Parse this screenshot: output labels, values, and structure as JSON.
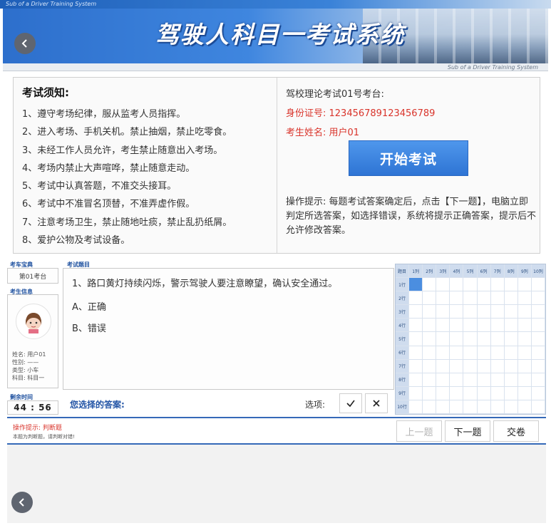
{
  "header": {
    "top_caption": "Sub of a Driver Training System",
    "title": "驾驶人科目一考试系统",
    "sub_caption": "Sub of a Driver Training System"
  },
  "rules": {
    "heading": "考试须知:",
    "items": [
      "1、遵守考场纪律，服从监考人员指挥。",
      "2、进入考场、手机关机。禁止抽烟，禁止吃零食。",
      "3、未经工作人员允许，考生禁止随意出入考场。",
      "4、考场内禁止大声喧哗，禁止随意走动。",
      "5、考试中认真答题，不准交头接耳。",
      "6、考试中不准冒名顶替，不准弄虚作假。",
      "7、注意考场卫生，禁止随地吐痰，禁止乱扔纸屑。",
      "8、爱护公物及考试设备。"
    ]
  },
  "exam_info": {
    "hall": "驾校理论考试01号考台:",
    "id_card": "身份证号: 123456789123456789",
    "name": "考生姓名: 用户01",
    "start_button": "开始考试",
    "tip": "操作提示: 每题考试答案确定后，点击【下一题】，电脑立即判定所选答案，如选择错误，系统将提示正确答案，提示后不允许修改答案。"
  },
  "exam_panel": {
    "seat_label": "考车宝典",
    "seat": "第01考台",
    "student_label": "考生信息",
    "student_meta": [
      "姓名: 用户01",
      "性别: ——",
      "类型: 小车",
      "科目: 科目一"
    ],
    "timer_label": "剩余时间",
    "timer": "44 : 56",
    "question_label": "考试题目",
    "question": "1、路口黄灯持续闪烁，警示驾驶人要注意瞭望，确认安全通过。",
    "options": [
      "A、正确",
      "B、错误"
    ],
    "answer_label": "您选择的答案:",
    "option_label": "选项:"
  },
  "grid": {
    "corner": "题目",
    "columns": [
      "1列",
      "2列",
      "3列",
      "4列",
      "5列",
      "6列",
      "7列",
      "8列",
      "9列",
      "10列"
    ],
    "rows": [
      "1行",
      "2行",
      "3行",
      "4行",
      "5行",
      "6行",
      "7行",
      "8行",
      "9行",
      "10行"
    ],
    "active": 0
  },
  "bottom": {
    "hint_title": "操作提示: 判断题",
    "hint_text": "本题为判断题，请判断对错!",
    "prev": "上一题",
    "next": "下一题",
    "submit": "交卷"
  },
  "colors": {
    "accent": "#2e74d4",
    "warning": "#d9342b",
    "divider": "#3569b8"
  }
}
